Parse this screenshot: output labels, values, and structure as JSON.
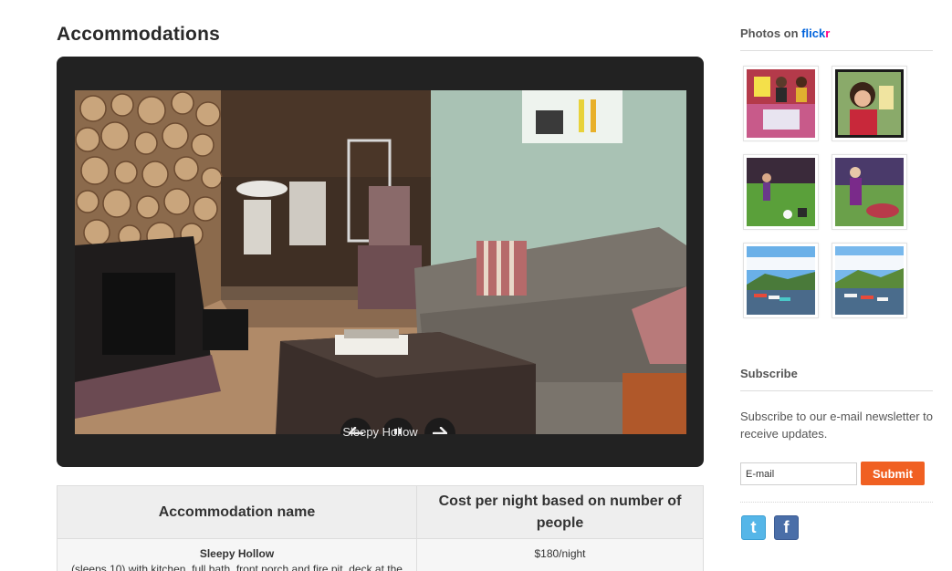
{
  "page": {
    "title": "Accommodations"
  },
  "slideshow": {
    "caption": "Sleepy Hollow",
    "controls": {
      "prev": "arrow-left-icon",
      "pause": "pause-icon",
      "next": "arrow-right-icon"
    }
  },
  "table": {
    "headers": [
      "Accommodation name",
      "Cost per night based on number of people"
    ],
    "rows": [
      {
        "name": "Sleepy Hollow",
        "description": "(sleeps 10) with kitchen, full bath, front porch and fire pit, deck at the",
        "cost": "$180/night"
      }
    ]
  },
  "sidebar": {
    "flickr": {
      "heading_prefix": "Photos on ",
      "brand_part1": "flick",
      "brand_part2": "r"
    },
    "subscribe": {
      "heading": "Subscribe",
      "text": "Subscribe to our e-mail newsletter to receive updates.",
      "email_placeholder": "E-mail",
      "submit_label": "Submit"
    },
    "social": {
      "twitter_glyph": "t",
      "facebook_glyph": "f"
    }
  },
  "colors": {
    "accent": "#f06022",
    "flickr_blue": "#0063dc",
    "flickr_pink": "#ff0084",
    "slideshow_bg": "#222222"
  }
}
